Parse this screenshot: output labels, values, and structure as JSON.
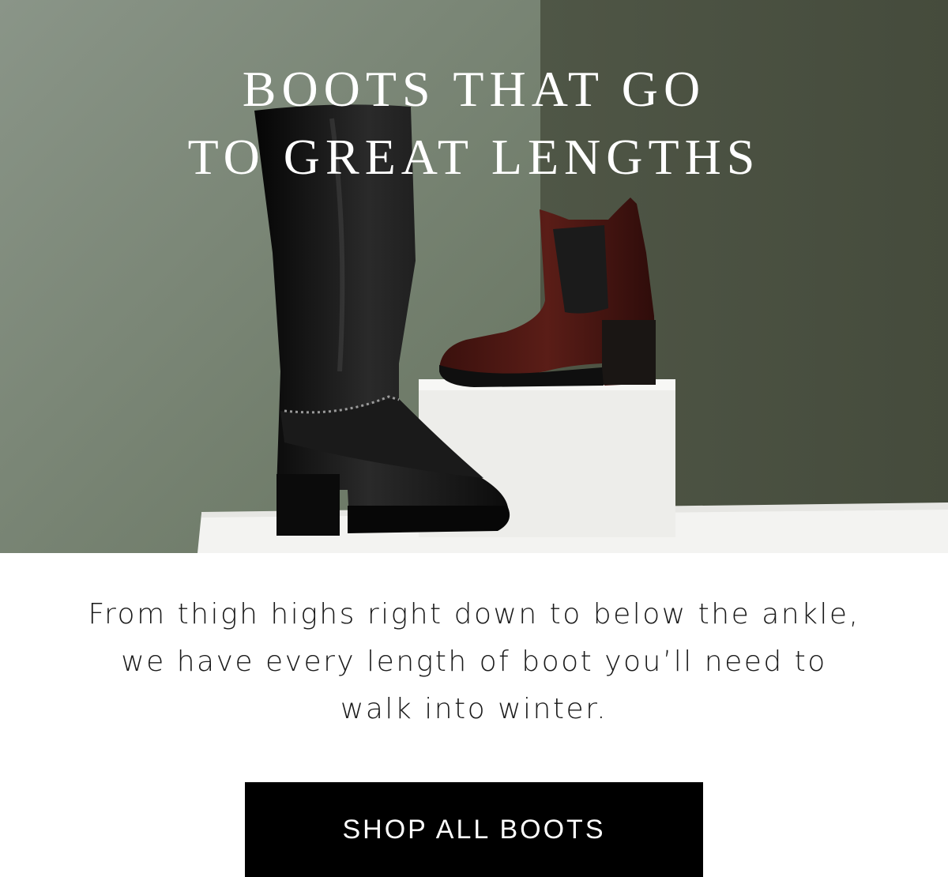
{
  "hero": {
    "title_lines": [
      "BOOTS THAT GO",
      "TO GREAT LENGTHS"
    ],
    "image_alt": "tall-black-leather-boot-and-burgundy-croc-ankle-boot"
  },
  "copy": {
    "lines": [
      "From thigh highs right down to below the ankle,",
      "we have every length of boot you’ll need to",
      "walk into winter."
    ]
  },
  "cta": {
    "label": "SHOP ALL BOOTS"
  },
  "colors": {
    "wall_left": "#7e8a7c",
    "wall_right": "#4b5242",
    "plinth": "#f4f4f2",
    "boot_black": "#111111",
    "boot_burgundy": "#4a1612",
    "button": "#000000"
  }
}
